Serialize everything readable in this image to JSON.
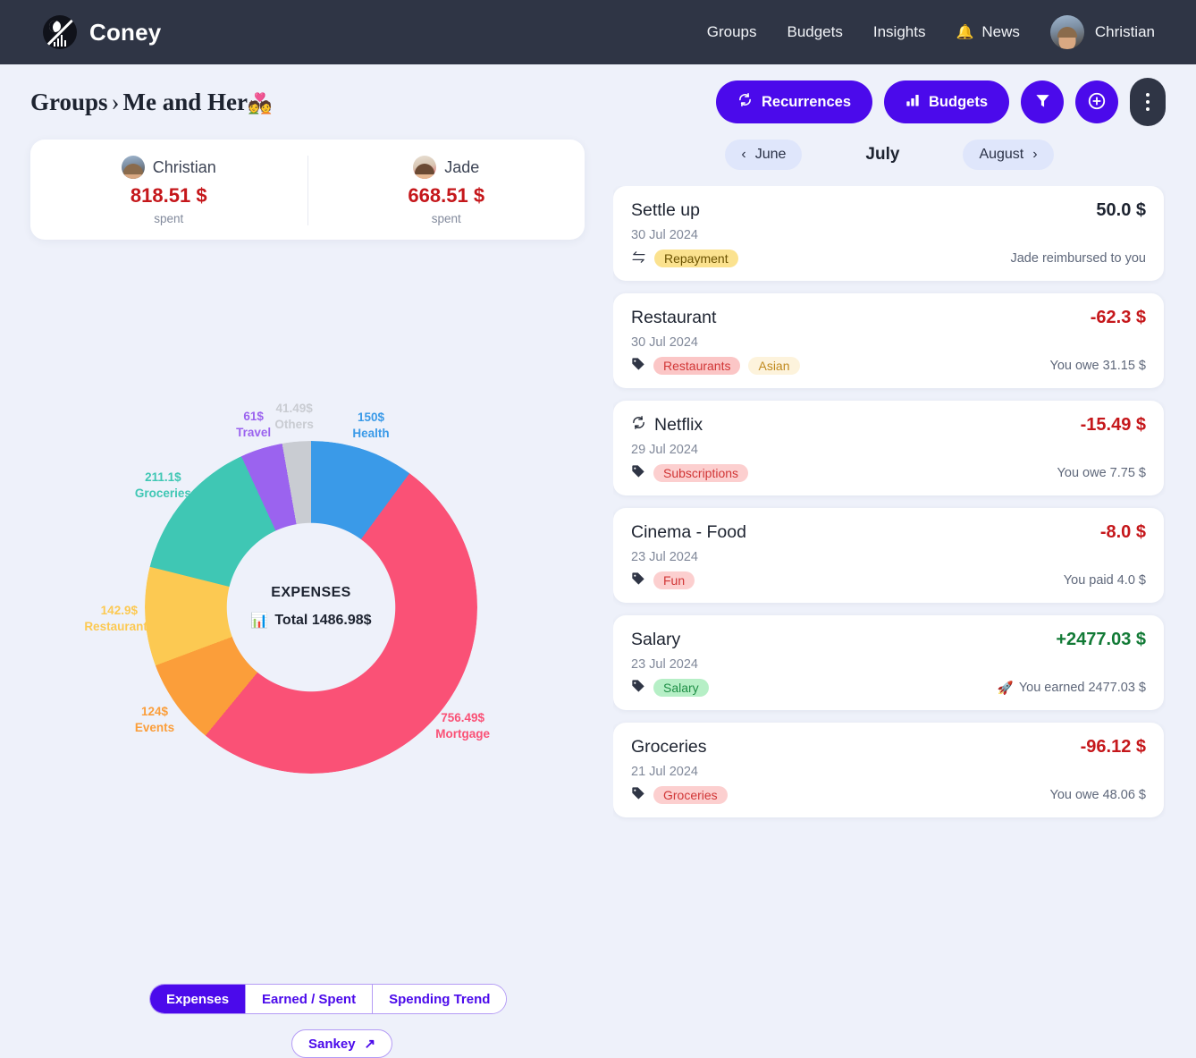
{
  "header": {
    "brand": "Coney",
    "brand_logo_icon": "moon-chart-logo",
    "nav": [
      {
        "label": "Groups",
        "icon": null
      },
      {
        "label": "Budgets",
        "icon": null
      },
      {
        "label": "Insights",
        "icon": null
      },
      {
        "label": "News",
        "icon": "bell-icon"
      }
    ],
    "user": {
      "name": "Christian",
      "avatar_icon": "user-avatar"
    }
  },
  "breadcrumb": {
    "root": "Groups",
    "separator": "›",
    "current": "Me and Her",
    "emoji": "💑"
  },
  "toolbar": {
    "recurrences_label": "Recurrences",
    "recurrences_icon": "refresh-icon",
    "budgets_label": "Budgets",
    "budgets_icon": "bar-chart-icon",
    "filter_icon": "funnel-icon",
    "add_icon": "plus-circle-icon",
    "more_icon": "more-vertical-icon",
    "accent_color": "#4b0aeb",
    "more_bg_color": "#2f3545"
  },
  "members": [
    {
      "name": "Christian",
      "amount": "818.51 $",
      "sublabel": "spent",
      "avatar_icon": "christian-avatar"
    },
    {
      "name": "Jade",
      "amount": "668.51 $",
      "sublabel": "spent",
      "avatar_icon": "jade-avatar"
    }
  ],
  "chart_center": {
    "title": "EXPENSES",
    "total_label": "Total 1486.98$",
    "icon": "bar-chart-emoji"
  },
  "chart_data": {
    "type": "pie",
    "title": "EXPENSES",
    "total": 1486.98,
    "total_label": "Total 1486.98$",
    "unit": "$",
    "legend": "labels-around-slices",
    "categories": [
      "Health",
      "Mortgage",
      "Events",
      "Restaurants",
      "Groceries",
      "Travel",
      "Others"
    ],
    "values": [
      150,
      756.49,
      124,
      142.9,
      211.1,
      61,
      41.49
    ],
    "colors": [
      "#3a9ae8",
      "#fa5176",
      "#fb9e3a",
      "#fcc952",
      "#3fc7b4",
      "#9b63ef",
      "#c9ccd2"
    ],
    "labels": [
      {
        "name": "Health",
        "value_label": "150$",
        "color": "#3a9ae8"
      },
      {
        "name": "Mortgage",
        "value_label": "756.49$",
        "color": "#fa5176"
      },
      {
        "name": "Events",
        "value_label": "124$",
        "color": "#fb9e3a"
      },
      {
        "name": "Restaurants",
        "value_label": "142.9$",
        "color": "#fcc952"
      },
      {
        "name": "Groceries",
        "value_label": "211.1$",
        "color": "#3fc7b4"
      },
      {
        "name": "Travel",
        "value_label": "61$",
        "color": "#9b63ef"
      },
      {
        "name": "Others",
        "value_label": "41.49$",
        "color": "#c9ccd2"
      }
    ]
  },
  "chart_tabs": [
    {
      "label": "Expenses",
      "active": true
    },
    {
      "label": "Earned / Spent",
      "active": false
    },
    {
      "label": "Spending Trend",
      "active": false
    }
  ],
  "sankey": {
    "label": "Sankey",
    "icon": "arrow-up-right-icon"
  },
  "months": {
    "prev": "June",
    "current": "July",
    "next": "August",
    "prev_icon": "chevron-left-icon",
    "next_icon": "chevron-right-icon"
  },
  "transactions": [
    {
      "title": "Settle up",
      "amount": "50.0 $",
      "amount_kind": "neu",
      "date": "30 Jul 2024",
      "title_icon": null,
      "tag_icon": "transfer-icon",
      "tags": [
        {
          "label": "Repayment",
          "bg": "#fbe28f",
          "fg": "#6b5200"
        }
      ],
      "note": "Jade reimbursed to you",
      "note_emoji": null
    },
    {
      "title": "Restaurant",
      "amount": "-62.3 $",
      "amount_kind": "neg",
      "date": "30 Jul 2024",
      "title_icon": null,
      "tag_icon": "tag-icon",
      "tags": [
        {
          "label": "Restaurants",
          "bg": "#fbc6c6",
          "fg": "#d13636"
        },
        {
          "label": "Asian",
          "bg": "#fdf3dc",
          "fg": "#c08a1e"
        }
      ],
      "note": "You owe 31.15 $",
      "note_emoji": null
    },
    {
      "title": "Netflix",
      "amount": "-15.49 $",
      "amount_kind": "neg",
      "date": "29 Jul 2024",
      "title_icon": "refresh-icon",
      "tag_icon": "tag-icon",
      "tags": [
        {
          "label": "Subscriptions",
          "bg": "#fccfcf",
          "fg": "#d13636"
        }
      ],
      "note": "You owe 7.75 $",
      "note_emoji": null
    },
    {
      "title": "Cinema - Food",
      "amount": "-8.0 $",
      "amount_kind": "neg",
      "date": "23 Jul 2024",
      "title_icon": null,
      "tag_icon": "tag-icon",
      "tags": [
        {
          "label": "Fun",
          "bg": "#fccfcf",
          "fg": "#d13636"
        }
      ],
      "note": "You paid 4.0 $",
      "note_emoji": null
    },
    {
      "title": "Salary",
      "amount": "+2477.03 $",
      "amount_kind": "pos",
      "date": "23 Jul 2024",
      "title_icon": null,
      "tag_icon": "tag-icon",
      "tags": [
        {
          "label": "Salary",
          "bg": "#b6efc6",
          "fg": "#1f8f46"
        }
      ],
      "note": "You earned 2477.03 $",
      "note_emoji": "🚀"
    },
    {
      "title": "Groceries",
      "amount": "-96.12 $",
      "amount_kind": "neg",
      "date": "21 Jul 2024",
      "title_icon": null,
      "tag_icon": "tag-icon",
      "tags": [
        {
          "label": "Groceries",
          "bg": "#fccfcf",
          "fg": "#d13636"
        }
      ],
      "note": "You owe 48.06 $",
      "note_emoji": null
    }
  ]
}
